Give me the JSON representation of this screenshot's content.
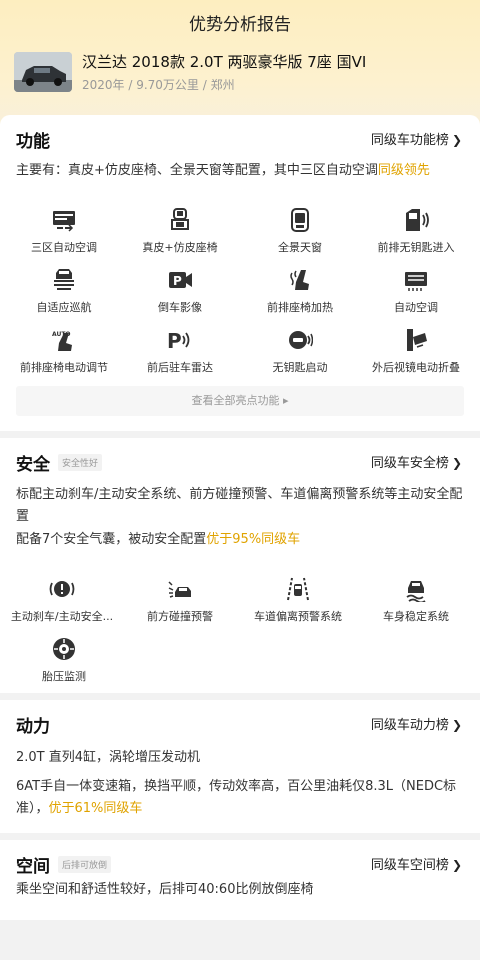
{
  "page": {
    "title": "优势分析报告"
  },
  "car": {
    "name": "汉兰达 2018款 2.0T 两驱豪华版 7座 国VI",
    "meta": "2020年 / 9.70万公里 / 郑州"
  },
  "function": {
    "title": "功能",
    "link": "同级车功能榜",
    "summary_prefix": "主要有：真皮+仿皮座椅、全景天窗等配置，其中三区自动空调",
    "summary_highlight": "级领先",
    "summary_hl_start": "同",
    "items": [
      {
        "label": "三区自动空调",
        "icon": "ac-panel-icon"
      },
      {
        "label": "真皮+仿皮座椅",
        "icon": "seat-icon"
      },
      {
        "label": "全景天窗",
        "icon": "sunroof-icon"
      },
      {
        "label": "前排无钥匙进入",
        "icon": "keyless-door-icon"
      },
      {
        "label": "自适应巡航",
        "icon": "adaptive-cruise-icon"
      },
      {
        "label": "倒车影像",
        "icon": "reverse-camera-icon"
      },
      {
        "label": "前排座椅加热",
        "icon": "seat-heating-icon"
      },
      {
        "label": "自动空调",
        "icon": "auto-ac-icon"
      },
      {
        "label": "前排座椅电动调节",
        "icon": "power-seat-icon"
      },
      {
        "label": "前后驻车雷达",
        "icon": "parking-radar-icon"
      },
      {
        "label": "无钥匙启动",
        "icon": "keyless-start-icon"
      },
      {
        "label": "外后视镜电动折叠",
        "icon": "mirror-fold-icon"
      }
    ],
    "view_all": "查看全部亮点功能 ▸"
  },
  "safety": {
    "title": "安全",
    "badge": "安全性好",
    "link": "同级车安全榜",
    "para1": "标配主动刹车/主动安全系统、前方碰撞预警、车道偏离预警系统等主动安全配置",
    "para2_prefix": "配备7个安全气囊，被动安全配置",
    "para2_highlight": "优于95%同级车",
    "items": [
      {
        "label": "主动刹车/主动安全...",
        "icon": "active-brake-icon"
      },
      {
        "label": "前方碰撞预警",
        "icon": "collision-warning-icon"
      },
      {
        "label": "车道偏离预警系统",
        "icon": "lane-departure-icon"
      },
      {
        "label": "车身稳定系统",
        "icon": "stability-control-icon"
      },
      {
        "label": "胎压监测",
        "icon": "tire-pressure-icon"
      }
    ]
  },
  "power": {
    "title": "动力",
    "link": "同级车动力榜",
    "para1": "2.0T 直列4缸，涡轮增压发动机",
    "para2_prefix": "6AT手自一体变速箱，换挡平顺，传动效率高，百公里油耗仅8.3L（NEDC标准），",
    "para2_highlight": "优于61%同级车"
  },
  "space": {
    "title": "空间",
    "badge": "后排可放倒",
    "link": "同级车空间榜",
    "para1": "乘坐空间和舒适性较好，后排可40:60比例放倒座椅"
  },
  "colors": {
    "accent": "#e0a300",
    "hero": "#fdeec0",
    "text": "#222222",
    "muted": "#999999"
  }
}
